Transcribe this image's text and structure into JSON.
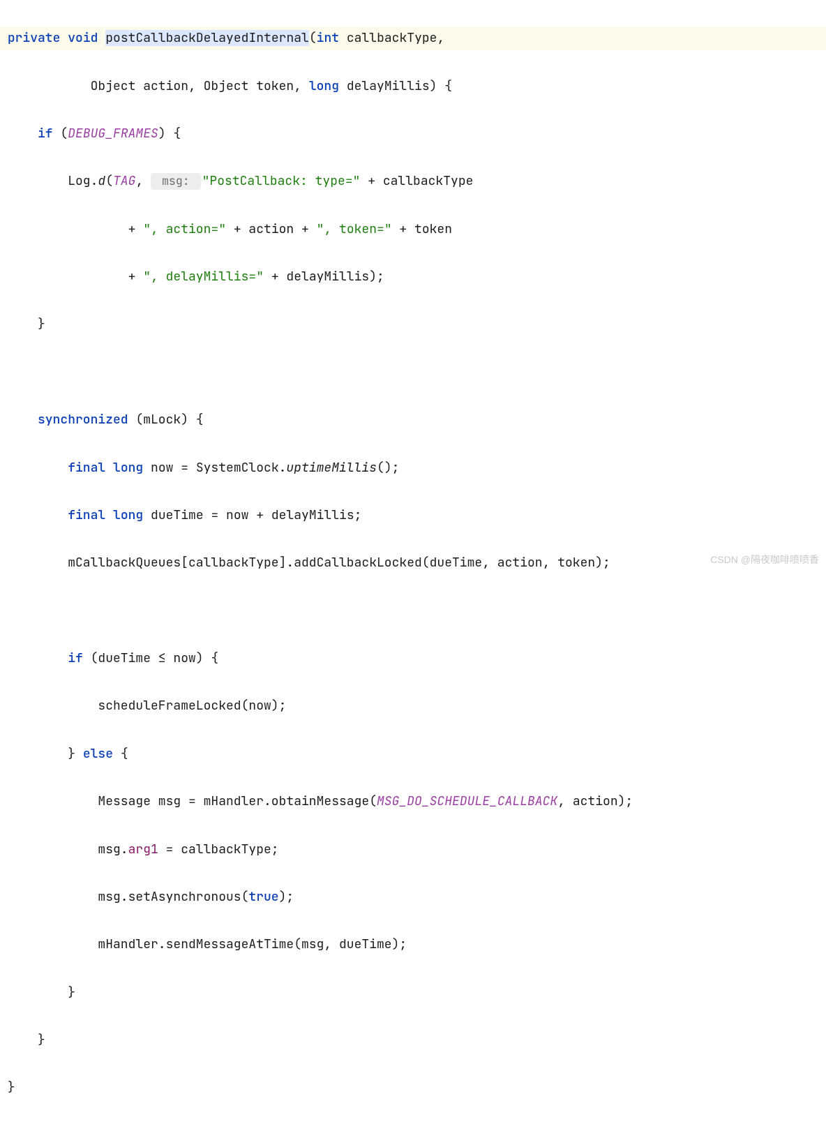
{
  "code": {
    "kw_private": "private",
    "kw_void": "void",
    "method_name": "postCallbackDelayedInternal",
    "sig_tail_1": "(",
    "kw_int": "int",
    "sig_tail_2": " callbackType,",
    "line2_pre": "            Object action, Object token, ",
    "kw_long": "long",
    "line2_post": " delayMillis) {",
    "kw_if": "if",
    "if_open": " (",
    "debug_frames": "DEBUG_FRAMES",
    "if_close": ") {",
    "log_pre": "Log.",
    "log_d": "d",
    "log_paren": "(",
    "tag_const": "TAG",
    "log_comma": ", ",
    "hint_msg": " msg: ",
    "str_type": "\"PostCallback: type=\"",
    "plus_cb": " + callbackType",
    "str_action": "\", action=\"",
    "mid1": " + action + ",
    "str_token": "\", token=\"",
    "mid2": " + token",
    "str_delay": "\", delayMillis=\"",
    "mid3": " + delayMillis);",
    "brace_close": "}",
    "kw_sync": "synchronized",
    "sync_open": " (mLock) {",
    "kw_final": "final",
    "kw_long2": "long",
    "now_assign": " now = SystemClock.",
    "uptime": "uptimeMillis",
    "now_tail": "();",
    "due_assign": " dueTime = now + delayMillis;",
    "cbq": "mCallbackQueues[callbackType].addCallbackLocked(dueTime, action, token);",
    "if2_open": " (dueTime ≤ now) {",
    "sched": "scheduleFrameLocked(now);",
    "brace_else_open": "} ",
    "kw_else": "else",
    "else_tail": " {",
    "msg_line_a": "Message msg = mHandler.obtainMessage(",
    "msg_const": "MSG_DO_SCHEDULE_CALLBACK",
    "msg_line_b": ", action);",
    "arg1_a": "msg.",
    "arg1_field": "arg1",
    "arg1_b": " = callbackType;",
    "async_a": "msg.setAsynchronous(",
    "kw_true": "true",
    "async_b": ");",
    "send_line": "mHandler.sendMessageAtTime(msg, dueTime);"
  },
  "watermark": "CSDN @隔夜咖啡喷喷香"
}
